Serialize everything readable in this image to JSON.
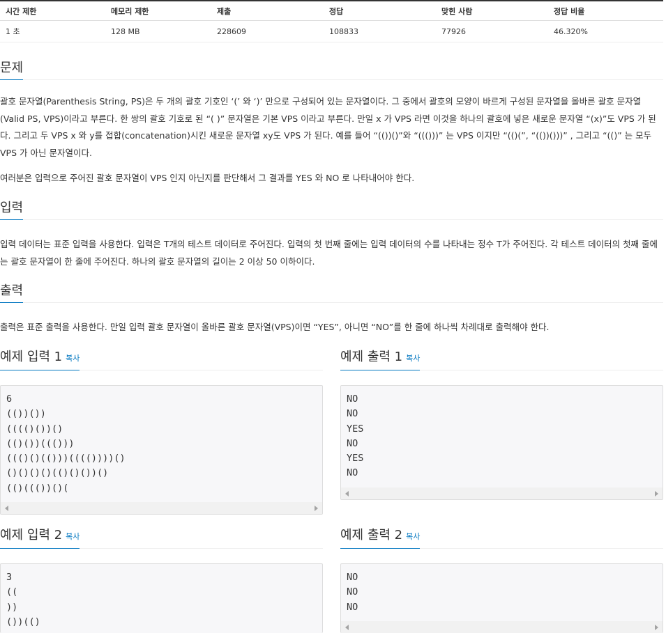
{
  "stats": {
    "headers": [
      "시간 제한",
      "메모리 제한",
      "제출",
      "정답",
      "맞힌 사람",
      "정답 비율"
    ],
    "values": [
      "1 초",
      "128 MB",
      "228609",
      "108833",
      "77926",
      "46.320%"
    ]
  },
  "problem": {
    "title": "문제",
    "p1": "괄호 문자열(Parenthesis String, PS)은 두 개의 괄호 기호인 ‘(’ 와 ‘)’ 만으로 구성되어 있는 문자열이다. 그 중에서 괄호의 모양이 바르게 구성된 문자열을 올바른 괄호 문자열(Valid PS, VPS)이라고 부른다. 한 쌍의 괄호 기호로 된 “( )” 문자열은 기본 VPS 이라고 부른다. 만일 x 가 VPS 라면 이것을 하나의 괄호에 넣은 새로운 문자열 “(x)”도 VPS 가 된다. 그리고 두 VPS x 와 y를 접합(concatenation)시킨 새로운 문자열 xy도 VPS 가 된다. 예를 들어 “(())()”와 “((()))” 는 VPS 이지만 “(()(”, “(())()))” , 그리고 “(()” 는 모두 VPS 가 아닌 문자열이다.",
    "p2": "여러분은 입력으로 주어진 괄호 문자열이 VPS 인지 아닌지를 판단해서 그 결과를 YES 와 NO 로 나타내어야 한다."
  },
  "input": {
    "title": "입력",
    "p1": "입력 데이터는 표준 입력을 사용한다. 입력은 T개의 테스트 데이터로 주어진다. 입력의 첫 번째 줄에는 입력 데이터의 수를 나타내는 정수 T가 주어진다. 각 테스트 데이터의 첫째 줄에는 괄호 문자열이 한 줄에 주어진다. 하나의 괄호 문자열의 길이는 2 이상 50 이하이다."
  },
  "output": {
    "title": "출력",
    "p1": "출력은 표준 출력을 사용한다. 만일 입력 괄호 문자열이 올바른 괄호 문자열(VPS)이면 “YES”, 아니면 “NO”를 한 줄에 하나씩 차례대로 출력해야 한다."
  },
  "copy_label": "복사",
  "samples": {
    "in1": {
      "title": "예제 입력 1",
      "text": "6\n(())())\n(((()())()\n(()())((()))\n((()()(()))(((())))()\n()()()()(()()())()\n(()((())()("
    },
    "out1": {
      "title": "예제 출력 1",
      "text": "NO\nNO\nYES\nNO\nYES\nNO"
    },
    "in2": {
      "title": "예제 입력 2",
      "text": "3\n((\n))\n())(()"
    },
    "out2": {
      "title": "예제 출력 2",
      "text": "NO\nNO\nNO"
    }
  }
}
